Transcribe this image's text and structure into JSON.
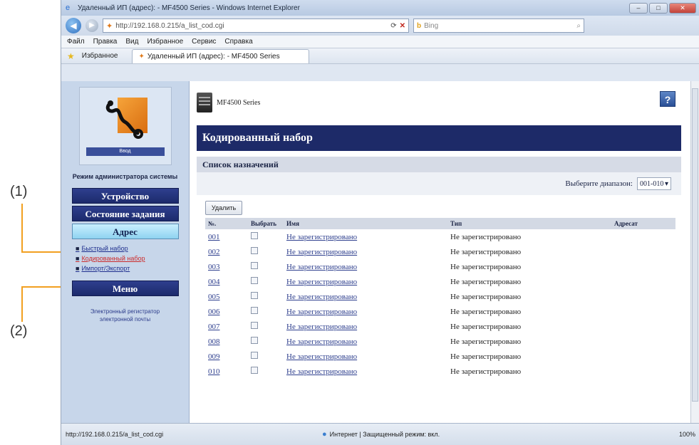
{
  "callouts": {
    "one": "(1)",
    "two": "(2)"
  },
  "browser": {
    "title": "Удаленный ИП (адрес): - MF4500 Series - Windows Internet Explorer",
    "address": "http://192.168.0.215/a_list_cod.cgi",
    "search_placeholder": "Bing",
    "menu": [
      "Файл",
      "Правка",
      "Вид",
      "Избранное",
      "Сервис",
      "Справка"
    ],
    "favorites_label": "Избранное",
    "tab_title": "Удаленный ИП (адрес): - MF4500 Series",
    "status_url": "http://192.168.0.215/a_list_cod.cgi",
    "status_zone": "Интернет | Защищенный режим: вкл.",
    "zoom": "100%"
  },
  "sidebar": {
    "logo_caption": "Ввод",
    "mode_text": "Режим администратора системы",
    "buttons": [
      "Устройство",
      "Состояние задания",
      "Адрес",
      "Меню"
    ],
    "selected": "Адрес",
    "sub_links": [
      "Быстрый набор",
      "Кодированный набор",
      "Импорт/Экспорт"
    ],
    "footer": "Электронный регистратор электронной почты"
  },
  "main": {
    "model_name": "MF4500 Series",
    "help_label": "?",
    "page_title": "Кодированный набор",
    "list_title": "Список назначений",
    "range_label": "Выберите диапазон:",
    "range_value": "001-010",
    "delete_label": "Удалить",
    "columns": [
      "№.",
      "Выбрать",
      "Имя",
      "Тип",
      "Адресат"
    ],
    "rows": [
      {
        "num": "001",
        "name": "Не зарегистрировано",
        "type": "Не зарегистрировано"
      },
      {
        "num": "002",
        "name": "Не зарегистрировано",
        "type": "Не зарегистрировано"
      },
      {
        "num": "003",
        "name": "Не зарегистрировано",
        "type": "Не зарегистрировано"
      },
      {
        "num": "004",
        "name": "Не зарегистрировано",
        "type": "Не зарегистрировано"
      },
      {
        "num": "005",
        "name": "Не зарегистрировано",
        "type": "Не зарегистрировано"
      },
      {
        "num": "006",
        "name": "Не зарегистрировано",
        "type": "Не зарегистрировано"
      },
      {
        "num": "007",
        "name": "Не зарегистрировано",
        "type": "Не зарегистрировано"
      },
      {
        "num": "008",
        "name": "Не зарегистрировано",
        "type": "Не зарегистрировано"
      },
      {
        "num": "009",
        "name": "Не зарегистрировано",
        "type": "Не зарегистрировано"
      },
      {
        "num": "010",
        "name": "Не зарегистрировано",
        "type": "Не зарегистрировано"
      }
    ]
  },
  "colors": {
    "header_navy": "#1d2a68",
    "callout_orange": "#f2a020",
    "selected_cyan": "#8fd3f0",
    "active_link_red": "#cc2b2b"
  },
  "icons": [
    "ie-icon",
    "back-arrow-icon",
    "forward-arrow-icon",
    "site-icon",
    "refresh-icon",
    "stop-icon",
    "search-icon",
    "star-icon",
    "printer-icon",
    "help-icon",
    "globe-icon"
  ]
}
